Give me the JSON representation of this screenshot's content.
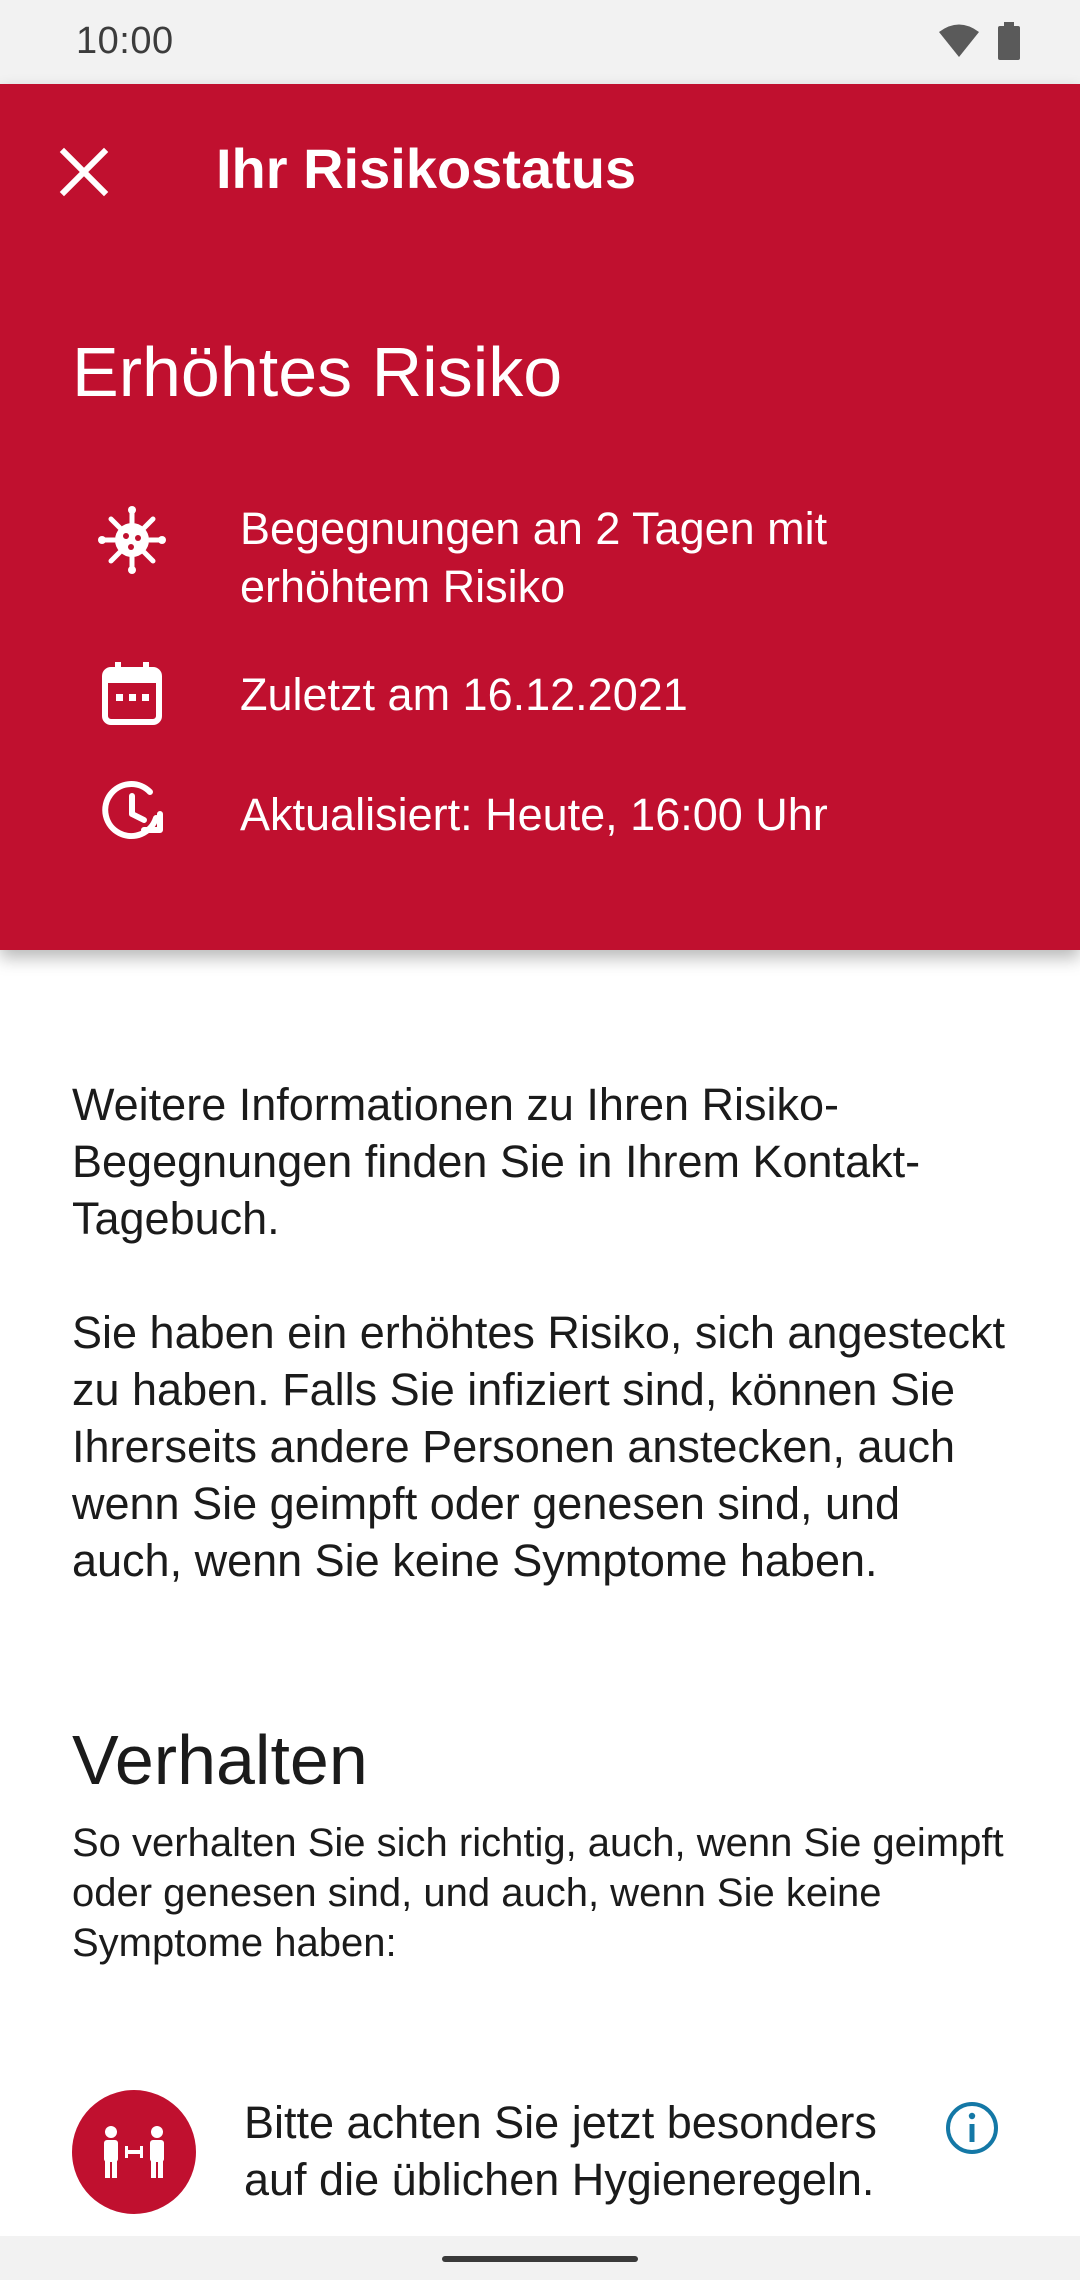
{
  "status_bar": {
    "time": "10:00",
    "icons": [
      "wifi-icon",
      "battery-icon"
    ]
  },
  "header": {
    "close_icon": "close-icon",
    "title": "Ihr Risikostatus",
    "risk_level": "Erhöhtes Risiko",
    "details": [
      {
        "icon": "virus-icon",
        "text": "Begegnungen an 2 Tagen mit erhöhtem Risiko"
      },
      {
        "icon": "calendar-icon",
        "text": "Zuletzt am 16.12.2021"
      },
      {
        "icon": "clock-update-icon",
        "text": "Aktualisiert: Heute, 16:00 Uhr"
      }
    ]
  },
  "body": {
    "info_paragraph": "Weitere Informationen zu Ihren Risiko-Begegnungen finden Sie in Ihrem Kontakt-Tagebuch.",
    "risk_paragraph": "Sie haben ein erhöhtes Risiko, sich angesteckt zu haben. Falls Sie infiziert sind, können Sie Ihrerseits andere Personen anstecken, auch wenn Sie geimpft oder genesen sind, und auch, wenn Sie keine Symptome haben.",
    "section_title": "Verhalten",
    "section_subtitle": "So verhalten Sie sich richtig, auch, wenn Sie geimpft oder genesen sind, und auch, wenn Sie keine Symptome haben:",
    "rules": [
      {
        "icon": "distance-icon",
        "text": "Bitte achten Sie jetzt besonders auf die üblichen Hygieneregeln."
      }
    ]
  },
  "colors": {
    "header_red": "#c0102f",
    "info_blue": "#1478a6"
  }
}
